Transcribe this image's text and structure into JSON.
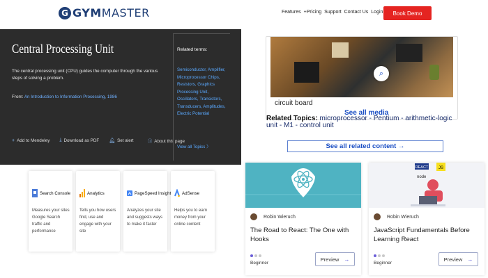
{
  "header": {
    "logo_mark": "G",
    "logo_text_bold": "GYM",
    "logo_text_rest": "MASTER",
    "nav": [
      "Features",
      "Pricing",
      "Support",
      "Contact Us",
      "Login"
    ],
    "cta": "Book Demo",
    "cta_color": "#e52421"
  },
  "definition": {
    "title": "Central Processing Unit",
    "description": "The central processing unit (CPU) guides the computer through the various steps of solving a problem.",
    "from_label": "From:",
    "from_source": "An Introduction to Information Processing, 1986",
    "actions": [
      "Add to Mendeley",
      "Download as PDF",
      "Set alert"
    ],
    "about": "About this page",
    "related_heading": "Related terms:",
    "related_terms": [
      "Semiconductor",
      "Amplifier",
      "Microprocessor Chips",
      "Resistors",
      "Graphics Processing Unit",
      "Oscillators",
      "Transistors",
      "Transducers",
      "Amplitudes",
      "Electric Potential"
    ],
    "view_all": "View all Topics"
  },
  "media": {
    "caption": "circuit board",
    "see_all_media": "See all media",
    "related_label": "Related Topics:",
    "related_topics": "microprocessor - Pentium - arithmetic-logic unit - M1 - control unit",
    "see_all_related": "See all related content →"
  },
  "tools": [
    {
      "name": "Search Console",
      "desc": "Measures your sites Google Search traffic and performance",
      "icon": "search-console-icon"
    },
    {
      "name": "Analytics",
      "desc": "Tells you how users find, use and engage with your site",
      "icon": "analytics-icon"
    },
    {
      "name": "PageSpeed Insights",
      "desc": "Analyzes your site and suggests ways to make it faster",
      "icon": "pagespeed-icon"
    },
    {
      "name": "AdSense",
      "desc": "Helps you to earn money from your online content",
      "icon": "adsense-icon"
    }
  ],
  "courses": [
    {
      "author": "Robin Wieruch",
      "title": "The Road to React: The One with Hooks",
      "level": "Beginner",
      "preview": "Preview",
      "level_dots": 1
    },
    {
      "author": "Robin Wieruch",
      "title": "JavaScript Fundamentals Before Learning React",
      "level": "Beginner",
      "preview": "Preview",
      "level_dots": 1,
      "badges": [
        "REACT",
        "JS",
        "node"
      ]
    }
  ]
}
